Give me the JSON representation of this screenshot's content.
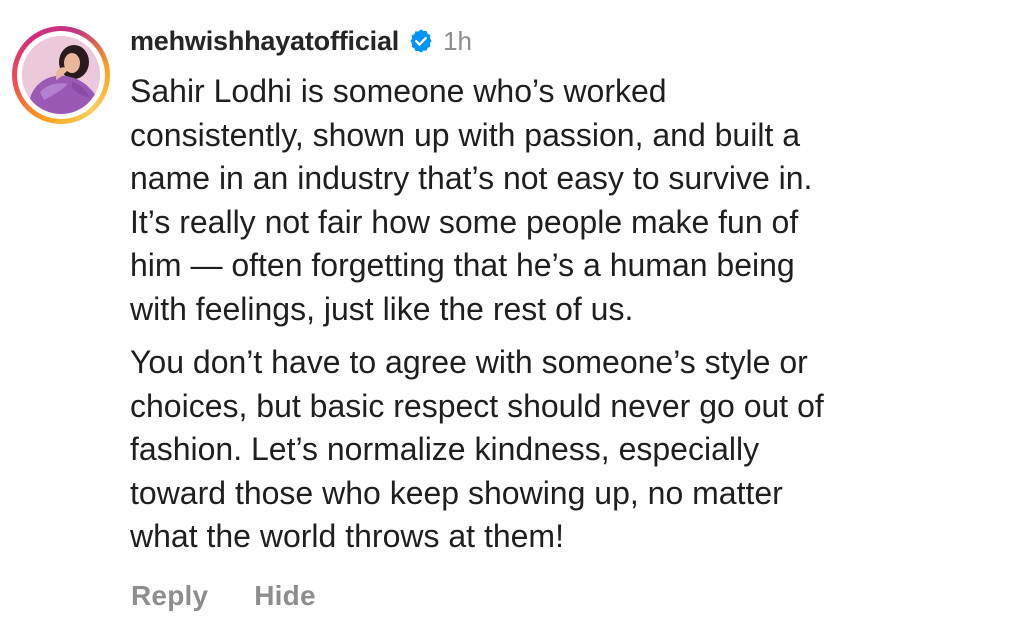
{
  "comment": {
    "username": "mehwishhayatofficial",
    "verified_icon": "verified-badge-icon",
    "timestamp": "1h",
    "paragraphs": [
      {
        "lines": [
          "Sahir Lodhi is someone who’s worked",
          "consistently, shown up with passion, and built a",
          "name in an industry that’s not easy to survive in.",
          "It’s really not fair how some people make fun of",
          "him — often forgetting that he’s a human being",
          "with feelings, just like the rest of us."
        ]
      },
      {
        "lines": [
          "You don’t have to agree with someone’s style or",
          "choices, but basic respect should never go out of",
          "fashion. Let’s normalize kindness, especially",
          "toward those who keep showing up, no matter",
          "what the world throws at them!"
        ]
      }
    ],
    "actions": {
      "reply_label": "Reply",
      "hide_label": "Hide"
    }
  },
  "colors": {
    "username": "#262626",
    "text": "#1f1f1f",
    "muted": "#8e8e8e",
    "verified": "#0095f6"
  }
}
